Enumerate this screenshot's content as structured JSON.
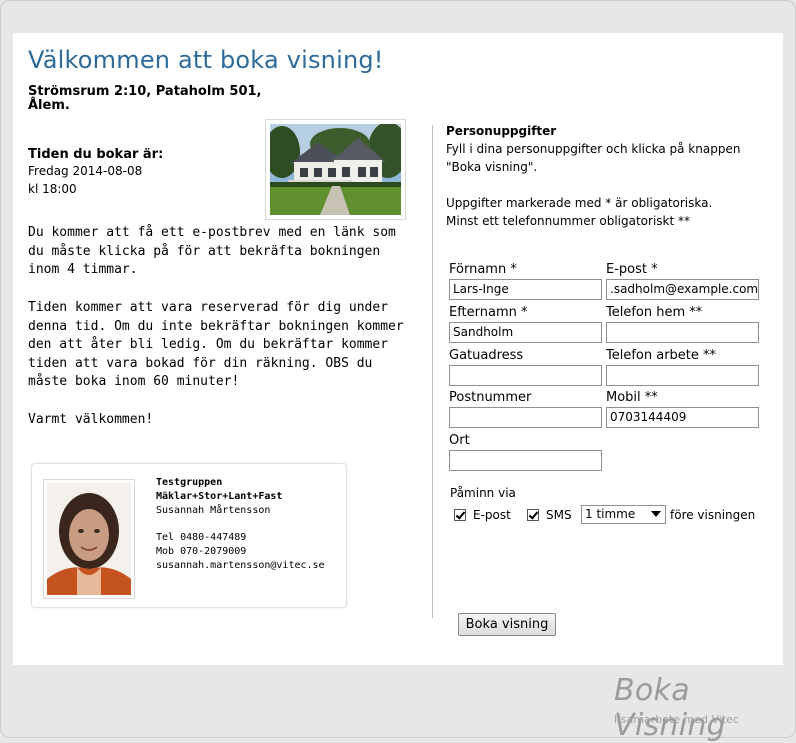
{
  "header": {
    "title": "Välkommen att boka visning!",
    "address": "Strömsrum 2:10, Pataholm 501, Ålem."
  },
  "booking": {
    "label": "Tiden du bokar är:",
    "date": "Fredag 2014-08-08",
    "time": "kl 18:00"
  },
  "info": {
    "p1": "Du kommer att få ett e-postbrev med en länk som du måste klicka på för att bekräfta bokningen inom 4 timmar.",
    "p2": "Tiden kommer att vara reserverad för dig under denna tid. Om du inte bekräftar bokningen kommer den att åter bli ledig. Om du bekräftar kommer tiden att vara bokad för din räkning. OBS du måste boka inom 60 minuter!",
    "p3": "Varmt välkommen!"
  },
  "agent": {
    "group": "Testgruppen",
    "company": "Mäklar+Stor+Lant+Fast",
    "name": "Susannah Mårtensson",
    "phone": "Tel 0480-447489",
    "mobile": "Mob 070-2079009",
    "email": "susannah.martensson@vitec.se"
  },
  "form": {
    "heading": "Personuppgifter",
    "intro_line1": "Fyll i dina personuppgifter och klicka på knappen",
    "intro_line2": "\"Boka visning\".",
    "required_note": "Uppgifter markerade med * är obligatoriska.",
    "phone_note": "Minst ett telefonnummer obligatoriskt **",
    "fields": {
      "first_name": {
        "label": "Förnamn *",
        "value": "Lars-Inge"
      },
      "email": {
        "label": "E-post *",
        "value": ".sadholm@example.com"
      },
      "last_name": {
        "label": "Efternamn *",
        "value": "Sandholm"
      },
      "phone_home": {
        "label": "Telefon hem **",
        "value": ""
      },
      "street": {
        "label": "Gatuadress",
        "value": ""
      },
      "phone_work": {
        "label": "Telefon arbete **",
        "value": ""
      },
      "postal_code": {
        "label": "Postnummer",
        "value": ""
      },
      "mobile": {
        "label": "Mobil **",
        "value": "0703144409"
      },
      "city": {
        "label": "Ort",
        "value": ""
      }
    },
    "reminder": {
      "label": "Påminn via",
      "email_label": "E-post",
      "email_checked": true,
      "sms_label": "SMS",
      "sms_checked": true,
      "interval_value": "1 timme",
      "suffix": "före visningen"
    },
    "submit_label": "Boka visning"
  },
  "footer": {
    "brand": "Boka Visning",
    "tagline": "I samarbete med Vitec"
  }
}
